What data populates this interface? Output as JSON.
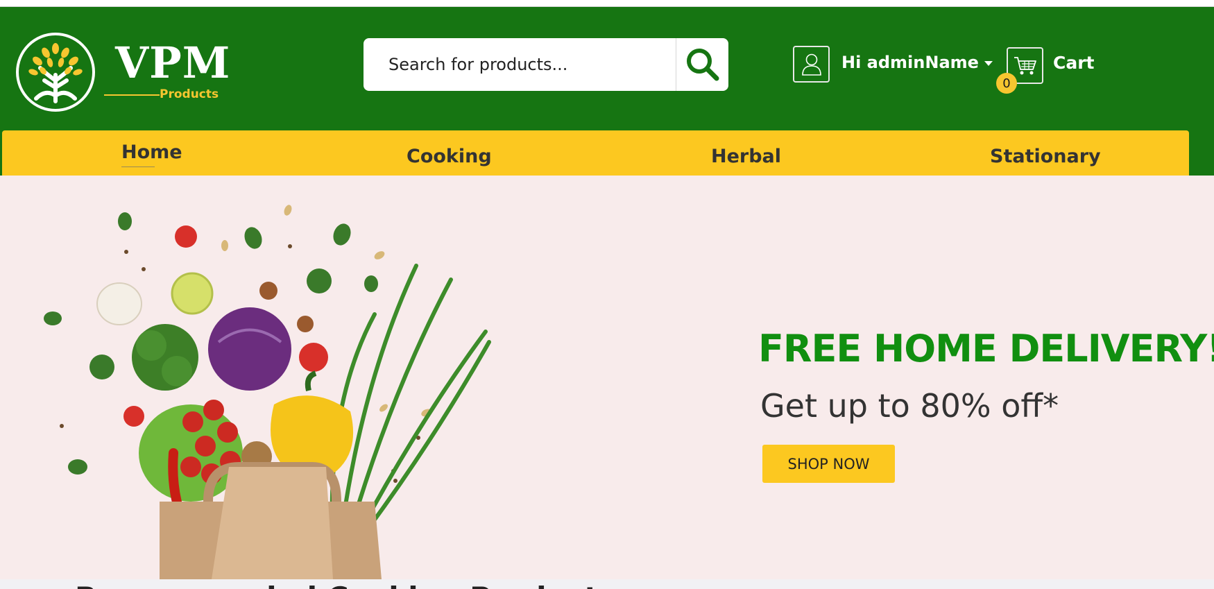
{
  "brand": {
    "name": "VPM",
    "tagline": "Products"
  },
  "search": {
    "placeholder": "Search for products..."
  },
  "user": {
    "greeting": "Hi adminName"
  },
  "cart": {
    "count": "0",
    "label": "Cart"
  },
  "categories": [
    {
      "label": "Home",
      "active": true
    },
    {
      "label": "Cooking",
      "active": false
    },
    {
      "label": "Herbal",
      "active": false
    },
    {
      "label": "Stationary",
      "active": false
    }
  ],
  "hero": {
    "title": "FREE HOME DELIVERY!",
    "subtitle": "Get up to 80% off*",
    "cta": "SHOP NOW"
  },
  "section": {
    "heading": "Recommended Cooking Products"
  },
  "colors": {
    "header_green": "#167512",
    "nav_yellow": "#fcc820",
    "hero_bg": "#f8ebeb",
    "headline_green": "#118f10"
  }
}
